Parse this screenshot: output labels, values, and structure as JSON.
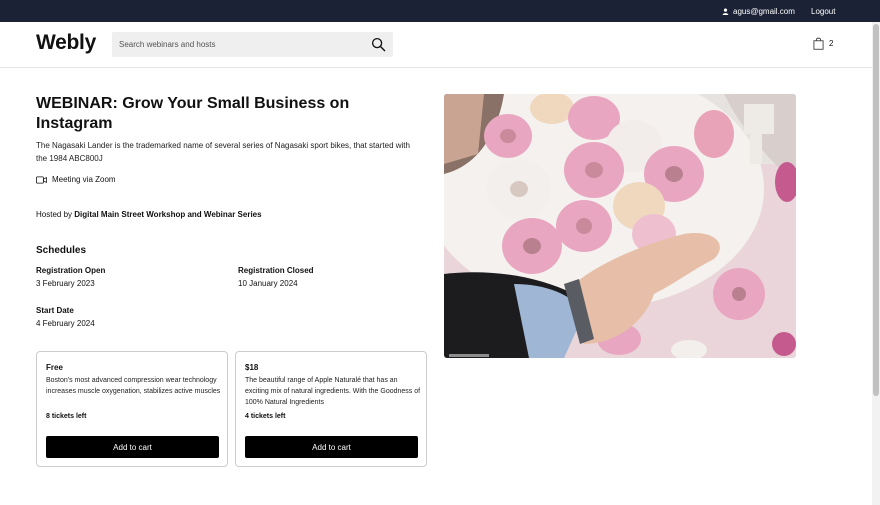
{
  "topbar": {
    "email": "agus@gmail.com",
    "logout": "Logout"
  },
  "header": {
    "logo": "Webly",
    "search_placeholder": "Search webinars and hosts",
    "cart_count": "2"
  },
  "event": {
    "title": "WEBINAR: Grow Your Small Business on Instagram",
    "description": "The Nagasaki Lander is the trademarked name of several series of Nagasaki sport bikes, that started with the 1984 ABC800J",
    "meeting": "Meeting via Zoom",
    "hosted_prefix": "Hosted by",
    "host": "Digital Main Street Workshop and Webinar Series"
  },
  "schedules": {
    "title": "Schedules",
    "registration_open_label": "Registration Open",
    "registration_open": "3 February 2023",
    "registration_closed_label": "Registration Closed",
    "registration_closed": "10 January 2024",
    "start_date_label": "Start Date",
    "start_date": "4 February 2024"
  },
  "tickets": [
    {
      "price": "Free",
      "description": "Boston's most advanced compression wear technology increases muscle oxygenation, stabilizes active muscles",
      "remaining": "8 tickets left",
      "button": "Add to cart"
    },
    {
      "price": "$18",
      "description": "The beautiful range of Apple Naturalé that has an exciting mix of natural ingredients. With the Goodness of 100% Natural Ingredients",
      "remaining": "4 tickets left",
      "button": "Add to cart"
    }
  ],
  "colors": {
    "topbar": "#1b2235",
    "button": "#000000",
    "icing_pink": "#e9a6c0"
  },
  "icons": {
    "user": "user-icon",
    "search": "search-icon",
    "cart": "shopping-bag-icon",
    "video": "video-camera-icon"
  }
}
